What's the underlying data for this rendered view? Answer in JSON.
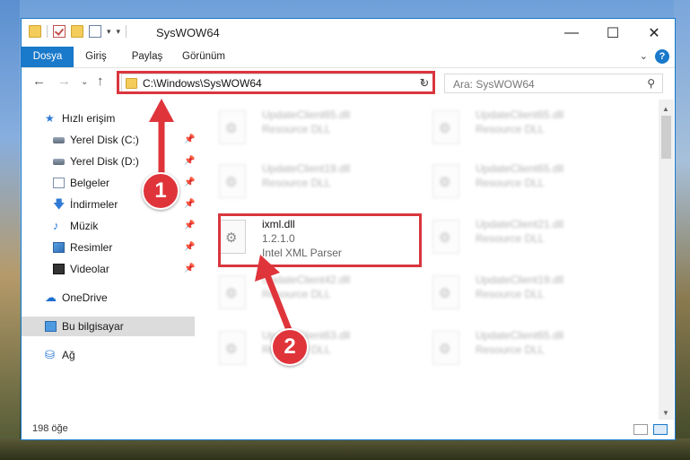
{
  "window": {
    "title": "SysWOW64",
    "controls": {
      "minimize": "—",
      "maximize": "☐",
      "close": "✕"
    }
  },
  "ribbon": {
    "tabs": [
      "Dosya",
      "Giriş",
      "Paylaş",
      "Görünüm"
    ],
    "help": "?"
  },
  "address": {
    "path": "C:\\Windows\\SysWOW64",
    "search_placeholder": "Ara: SysWOW64"
  },
  "sidebar": {
    "quick_access": "Hızlı erişim",
    "items": [
      {
        "label": "Yerel Disk (C:)",
        "icon": "drive-icon",
        "pinned": true
      },
      {
        "label": "Yerel Disk (D:)",
        "icon": "drive-icon",
        "pinned": true
      },
      {
        "label": "Belgeler",
        "icon": "documents-icon",
        "pinned": true
      },
      {
        "label": "İndirmeler",
        "icon": "download-icon",
        "pinned": true
      },
      {
        "label": "Müzik",
        "icon": "music-icon",
        "pinned": true
      },
      {
        "label": "Resimler",
        "icon": "pictures-icon",
        "pinned": true
      },
      {
        "label": "Videolar",
        "icon": "videos-icon",
        "pinned": true
      }
    ],
    "onedrive": "OneDrive",
    "this_pc": "Bu bilgisayar",
    "network": "Ağ"
  },
  "files": [
    {
      "name": "UpdateClient65.dll",
      "desc": "Resource DLL",
      "blurred": true
    },
    {
      "name": "UpdateClient65.dll",
      "desc": "Resource DLL",
      "blurred": true
    },
    {
      "name": "UpdateClient19.dll",
      "desc": "Resource DLL",
      "blurred": true
    },
    {
      "name": "UpdateClient65.dll",
      "desc": "Resource DLL",
      "blurred": true
    },
    {
      "name": "ixml.dll",
      "version": "1.2.1.0",
      "desc": "Intel XML Parser",
      "blurred": false
    },
    {
      "name": "UpdateClient21.dll",
      "desc": "Resource DLL",
      "blurred": true
    },
    {
      "name": "UpdateClient42.dll",
      "desc": "Resource DLL",
      "blurred": true
    },
    {
      "name": "UpdateClient19.dll",
      "desc": "Resource DLL",
      "blurred": true
    },
    {
      "name": "UpdateClient63.dll",
      "desc": "Resource DLL",
      "blurred": true
    },
    {
      "name": "UpdateClient65.dll",
      "desc": "Resource DLL",
      "blurred": true
    }
  ],
  "status": {
    "count": "198 öğe"
  },
  "annotations": {
    "step1": "1",
    "step2": "2",
    "color": "#e0343b"
  }
}
